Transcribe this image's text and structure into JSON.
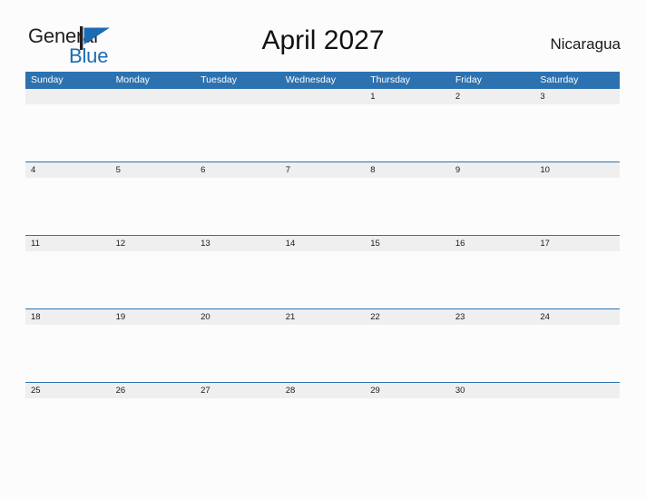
{
  "brand": {
    "line1": "General",
    "line2": "Blue",
    "mark_icon": "flag-triangle-icon",
    "color_dark": "#231f20",
    "color_blue": "#1b6cb3"
  },
  "header": {
    "title": "April 2027",
    "region": "Nicaragua"
  },
  "theme": {
    "header_blue": "#2d72b0",
    "band_gray": "#efefef",
    "page_background": "#fcfcfd",
    "text_dark": "#1a1a1a"
  },
  "calendar": {
    "weekdays": [
      "Sunday",
      "Monday",
      "Tuesday",
      "Wednesday",
      "Thursday",
      "Friday",
      "Saturday"
    ],
    "weeks": [
      [
        "",
        "",
        "",
        "",
        "1",
        "2",
        "3"
      ],
      [
        "4",
        "5",
        "6",
        "7",
        "8",
        "9",
        "10"
      ],
      [
        "11",
        "12",
        "13",
        "14",
        "15",
        "16",
        "17"
      ],
      [
        "18",
        "19",
        "20",
        "21",
        "22",
        "23",
        "24"
      ],
      [
        "25",
        "26",
        "27",
        "28",
        "29",
        "30",
        ""
      ]
    ]
  }
}
